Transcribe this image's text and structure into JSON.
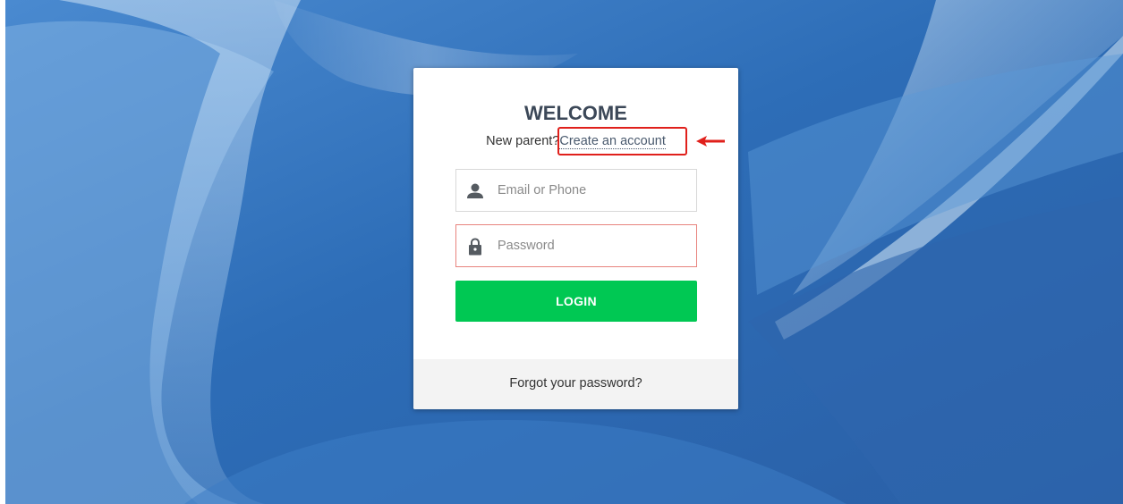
{
  "colors": {
    "background": "#2f6fb8",
    "card": "#ffffff",
    "title": "#3c4858",
    "login_button": "#00c853",
    "annotation": "#e0201b",
    "error_border": "#e8837d",
    "footer": "#f3f3f3"
  },
  "login_card": {
    "title": "WELCOME",
    "signup_prompt": "New parent?",
    "signup_link": "Create an account",
    "email_field": {
      "icon": "user-icon",
      "placeholder": "Email or Phone",
      "value": ""
    },
    "password_field": {
      "icon": "lock-icon",
      "placeholder": "Password",
      "value": "",
      "state": "error"
    },
    "login_button": "LOGIN",
    "forgot_password": "Forgot your password?"
  },
  "annotation": {
    "type": "highlight-box-with-arrow",
    "target": "signup_link"
  }
}
